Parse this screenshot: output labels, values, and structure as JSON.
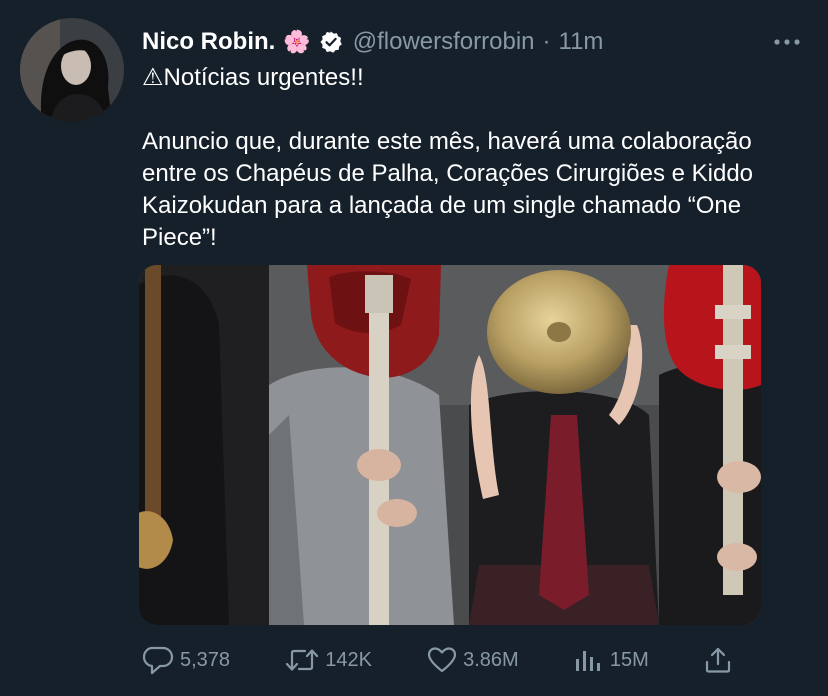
{
  "tweet": {
    "author_name": "Nico Robin.",
    "author_emoji": "🌸",
    "handle": "@flowersforrobin",
    "separator": "·",
    "time": "11m",
    "text": "⚠Notícias urgentes!!\n\nAnuncio que, durante este mês, haverá uma colaboração entre os Chapéus de Palha, Corações Cirurgiões e Kiddo Kaizokudan para a lançada de um single chamado “One Piece”!"
  },
  "actions": {
    "reply_count": "5,378",
    "retweet_count": "142K",
    "like_count": "3.86M",
    "views_count": "15M"
  },
  "colors": {
    "background": "#15202b",
    "text": "#ffffff",
    "secondary": "#8899a6",
    "guitar_red": "#b8141c",
    "cymbal": "#b9a064"
  },
  "icons": [
    "verified-badge-icon",
    "more-icon",
    "reply-icon",
    "retweet-icon",
    "like-icon",
    "analytics-icon",
    "share-icon"
  ]
}
